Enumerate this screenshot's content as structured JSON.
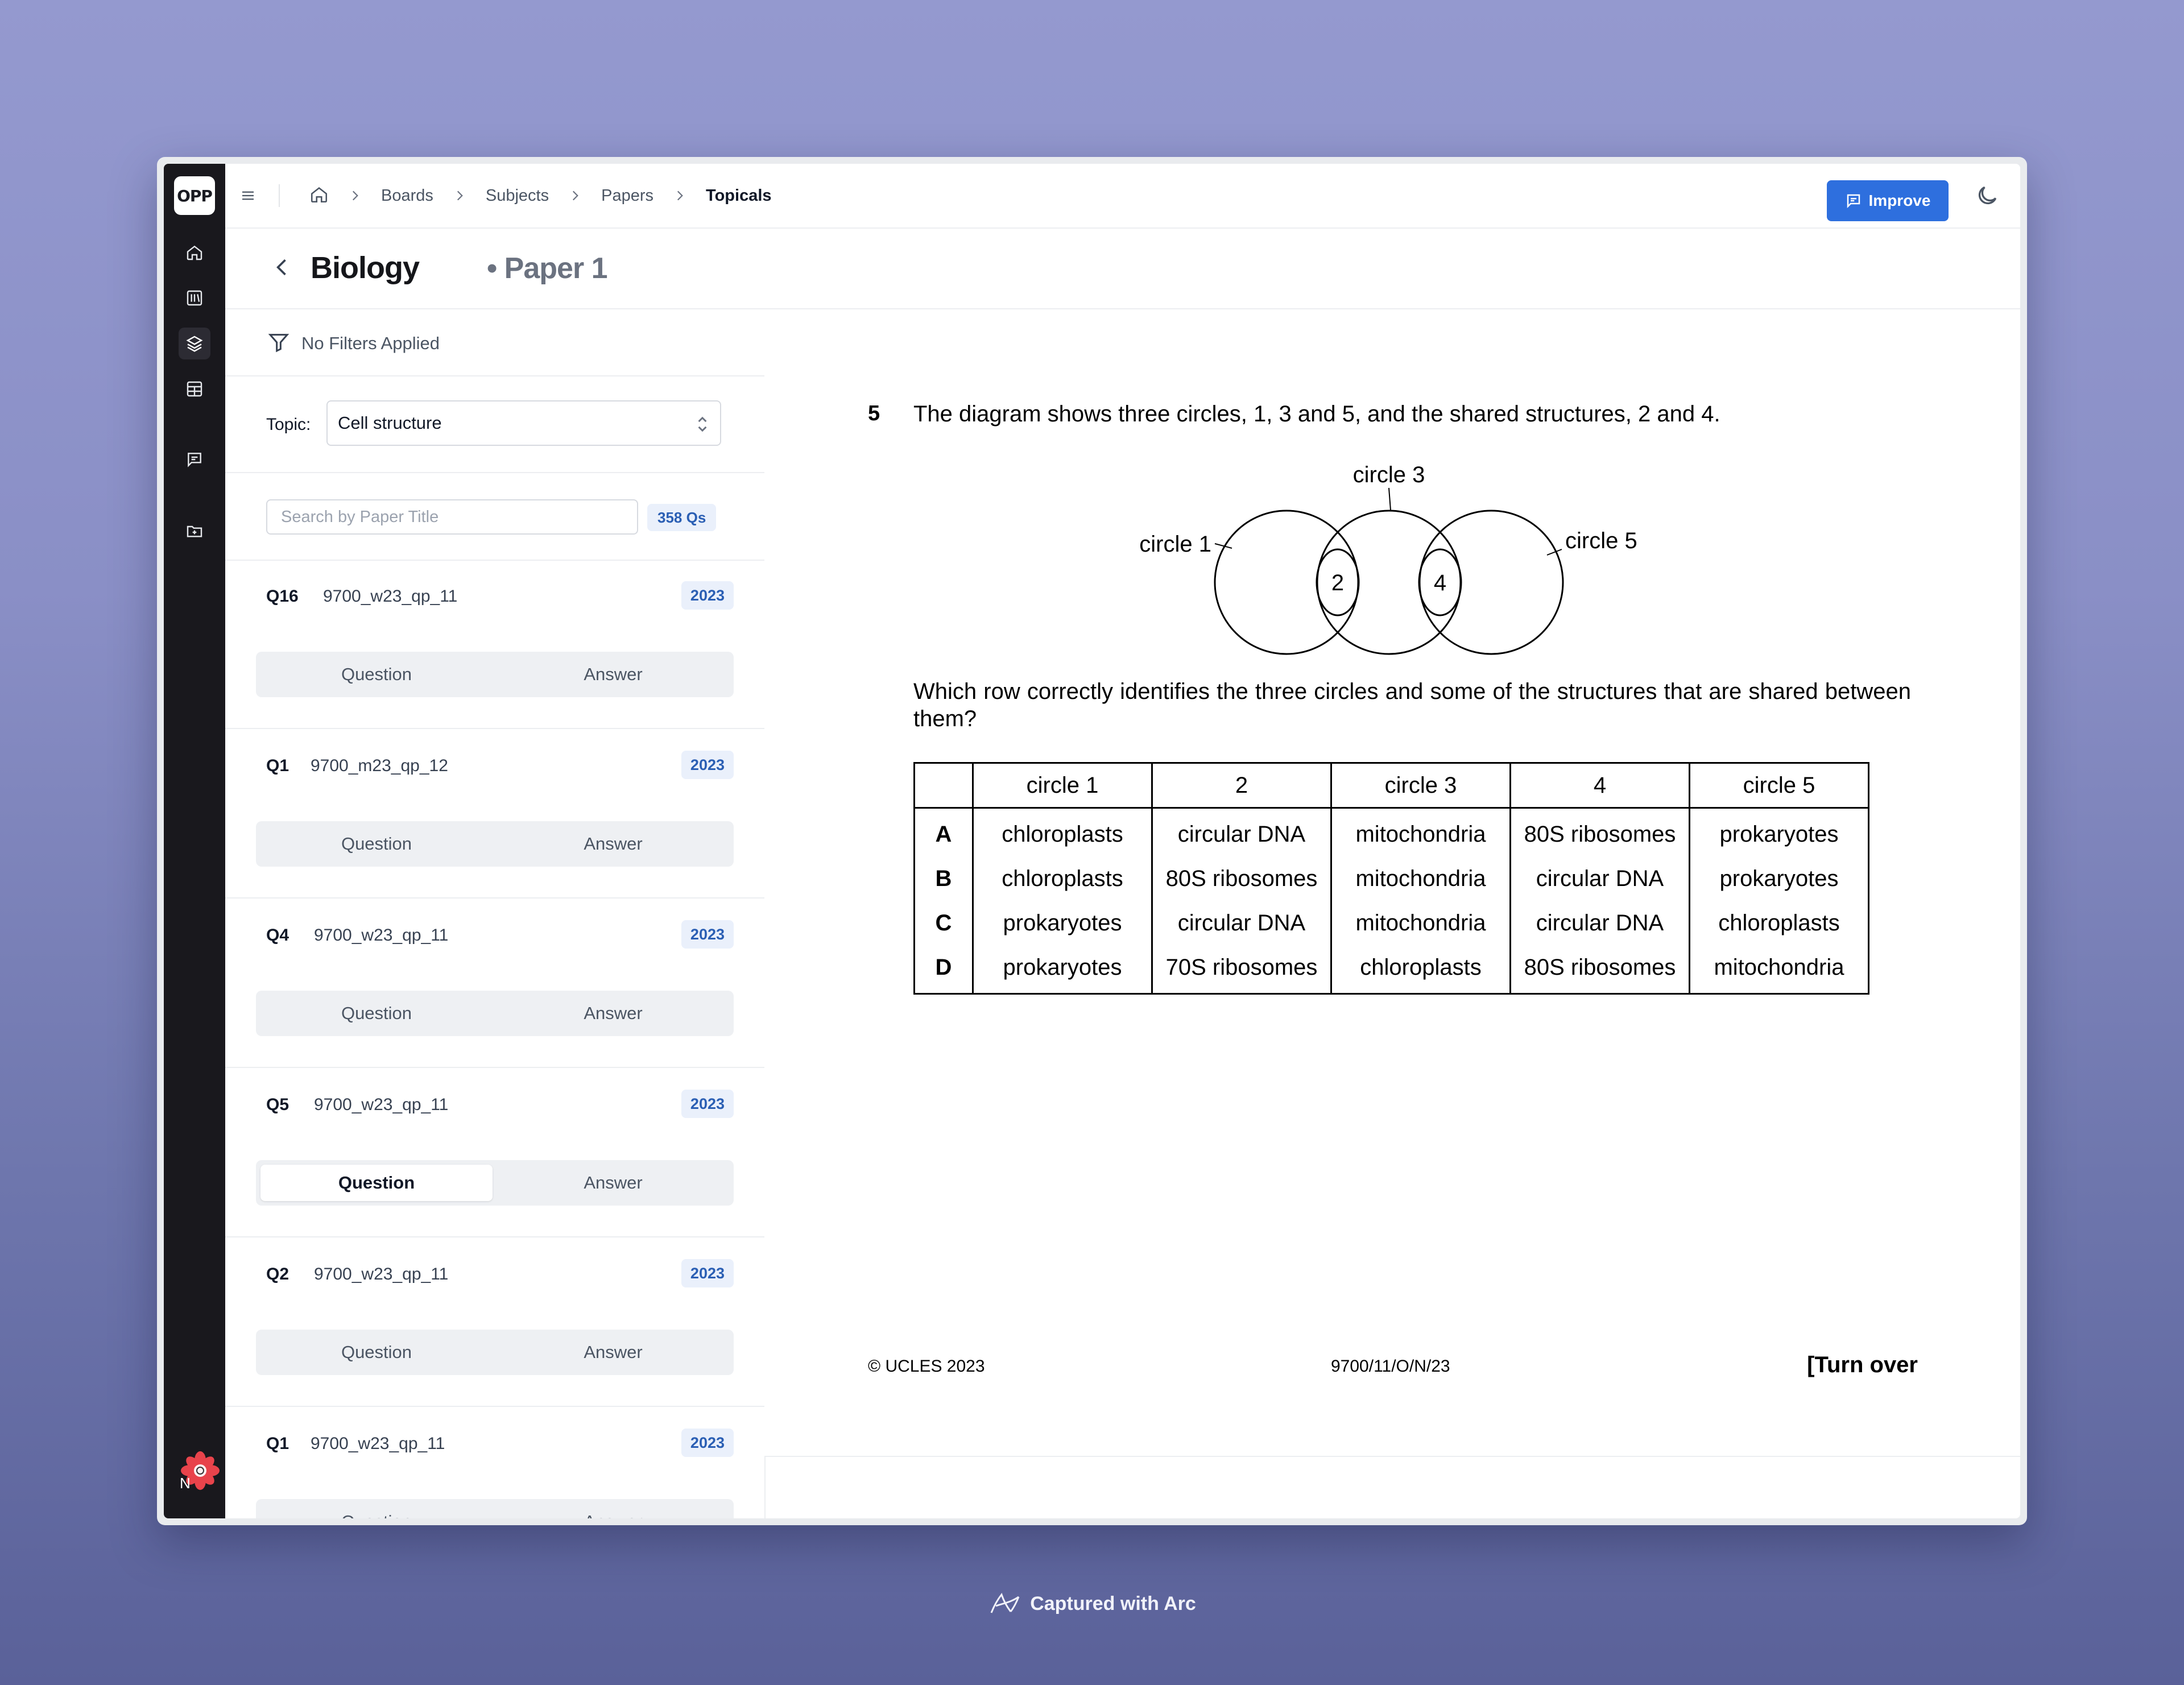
{
  "app": {
    "logo": "OPP",
    "avatar_letter": "N"
  },
  "breadcrumbs": [
    "Boards",
    "Subjects",
    "Papers",
    "Topicals"
  ],
  "toolbar": {
    "improve_label": "Improve"
  },
  "header": {
    "subject": "Biology",
    "paper": "• Paper 1"
  },
  "filters": {
    "status": "No Filters Applied"
  },
  "sidebar_panel": {
    "topic_label": "Topic:",
    "topic_value": "Cell structure",
    "search_placeholder": "Search by Paper Title",
    "count": "358 Qs",
    "items": [
      {
        "num": "Q16",
        "code": "9700_w23_qp_11",
        "year": "2023",
        "question": "Question",
        "answer": "Answer"
      },
      {
        "num": "Q1",
        "code": "9700_m23_qp_12",
        "year": "2023",
        "question": "Question",
        "answer": "Answer"
      },
      {
        "num": "Q4",
        "code": "9700_w23_qp_11",
        "year": "2023",
        "question": "Question",
        "answer": "Answer"
      },
      {
        "num": "Q5",
        "code": "9700_w23_qp_11",
        "year": "2023",
        "question": "Question",
        "answer": "Answer"
      },
      {
        "num": "Q2",
        "code": "9700_w23_qp_11",
        "year": "2023",
        "question": "Question",
        "answer": "Answer"
      },
      {
        "num": "Q1",
        "code": "9700_w23_qp_11",
        "year": "2023",
        "question": "Question",
        "answer": "Answer"
      }
    ],
    "active_item": 3
  },
  "document": {
    "number": "5",
    "stem": "The diagram shows three circles, 1, 3 and 5, and the shared structures, 2 and 4.",
    "diagram": {
      "label_circle1": "circle 1",
      "label_circle3": "circle 3",
      "label_circle5": "circle 5",
      "label_shared_a": "2",
      "label_shared_b": "4"
    },
    "prompt": "Which row correctly identifies the three circles and some of the structures that are shared between them?",
    "table": {
      "headers": [
        "",
        "circle 1",
        "2",
        "circle 3",
        "4",
        "circle 5"
      ],
      "rows": [
        [
          "A",
          "chloroplasts",
          "circular DNA",
          "mitochondria",
          "80S ribosomes",
          "prokaryotes"
        ],
        [
          "B",
          "chloroplasts",
          "80S ribosomes",
          "mitochondria",
          "circular DNA",
          "prokaryotes"
        ],
        [
          "C",
          "prokaryotes",
          "circular DNA",
          "mitochondria",
          "circular DNA",
          "chloroplasts"
        ],
        [
          "D",
          "prokaryotes",
          "70S ribosomes",
          "chloroplasts",
          "80S ribosomes",
          "mitochondria"
        ]
      ]
    },
    "footer_left": "© UCLES 2023",
    "footer_mid": "9700/11/O/N/23",
    "footer_right": "[Turn over"
  },
  "capture_label": "Captured with Arc",
  "colors": {
    "accent": "#2e6fde",
    "rail": "#19181d",
    "badge_bg": "#eaf0fb",
    "badge_text": "#2b5fb4"
  }
}
